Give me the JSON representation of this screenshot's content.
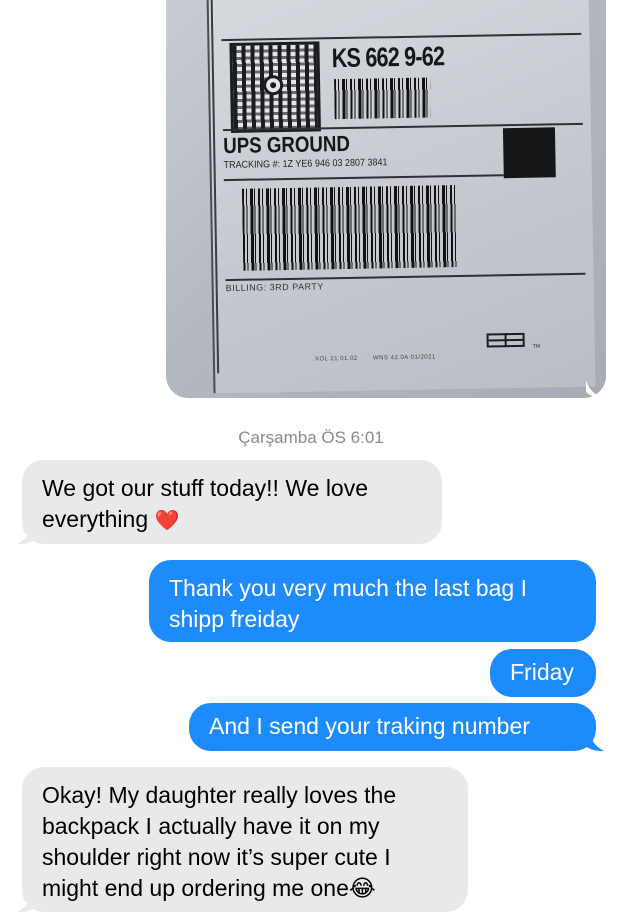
{
  "shipping_label": {
    "routing_code": "KS 662 9-62",
    "service": "UPS GROUND",
    "tracking": "TRACKING #: 1Z YE6 946 03 2807 3841",
    "billing": "BILLING: 3RD PARTY",
    "footer_left": "XOL 21 01.02",
    "footer_right": "WNS 42.0A 01/2021",
    "trademark": "TM"
  },
  "conversation": {
    "timestamp": "Çarşamba ÖS 6:01",
    "messages": [
      {
        "direction": "incoming",
        "lines": [
          "We got our stuff today!! We love",
          "everything"
        ],
        "emoji": "heart"
      },
      {
        "direction": "outgoing",
        "lines": [
          "Thank you very much the last bag I",
          "shipp freiday"
        ]
      },
      {
        "direction": "outgoing",
        "lines": [
          "Friday"
        ]
      },
      {
        "direction": "outgoing",
        "lines": [
          "And I send your traking number"
        ]
      },
      {
        "direction": "incoming",
        "lines": [
          "Okay! My daughter really loves the",
          "backpack I actually have it on my",
          "shoulder right now it’s super cute I",
          "might end up ordering me one"
        ],
        "emoji": "laughing-tears"
      }
    ]
  },
  "colors": {
    "outgoing_bubble": "#1d8bfb",
    "incoming_bubble": "#e9e9eb",
    "timestamp_text": "#8a8a8e"
  }
}
